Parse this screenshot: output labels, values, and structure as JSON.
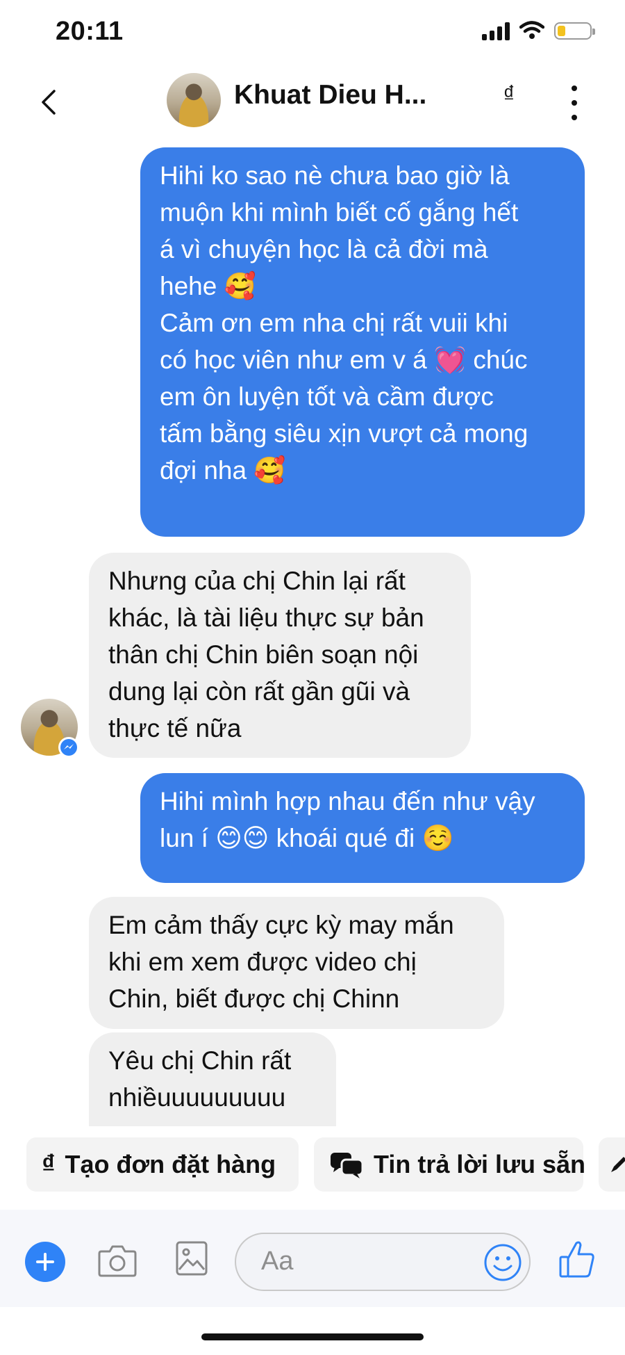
{
  "status": {
    "time": "20:11"
  },
  "header": {
    "contact_name": "Khuat Dieu H...",
    "currency_symbol": "₫"
  },
  "messages": [
    {
      "dir": "out",
      "text": "Hihi ko sao nè chưa bao giờ là\nmuộn khi mình biết cố gắng hết\ná vì chuyện học là cả đời mà\nhehe 🥰\nCảm ơn em nha chị rất vuii khi\ncó học viên như em v á 💓 chúc\nem ôn luyện tốt và cầm được\ntấm bằng siêu xịn vượt cả mong\nđợi nha 🥰"
    },
    {
      "dir": "in",
      "text": "Nhưng của chị Chin lại rất\nkhác, là tài liệu thực sự bản\nthân chị Chin biên soạn nội\ndung lại còn rất gần gũi và\nthực tế nữa"
    },
    {
      "dir": "out",
      "text": "Hihi mình hợp nhau đến như vậy\nlun í 😊😊 khoái qué đi ☺️"
    },
    {
      "dir": "in",
      "text": "Em cảm thấy cực kỳ may mắn\nkhi em xem được video chị\nChin, biết được chị Chinn"
    },
    {
      "dir": "in",
      "text": "Yêu chị Chin rất\nnhiềuuuuuuuuu"
    }
  ],
  "quick_replies": [
    {
      "label": "Tạo đơn đặt hàng",
      "icon": "currency-icon"
    },
    {
      "label": "Tin trả lời lưu sẵn",
      "icon": "chat-bubbles-icon"
    }
  ],
  "composer": {
    "placeholder": "Aa"
  }
}
